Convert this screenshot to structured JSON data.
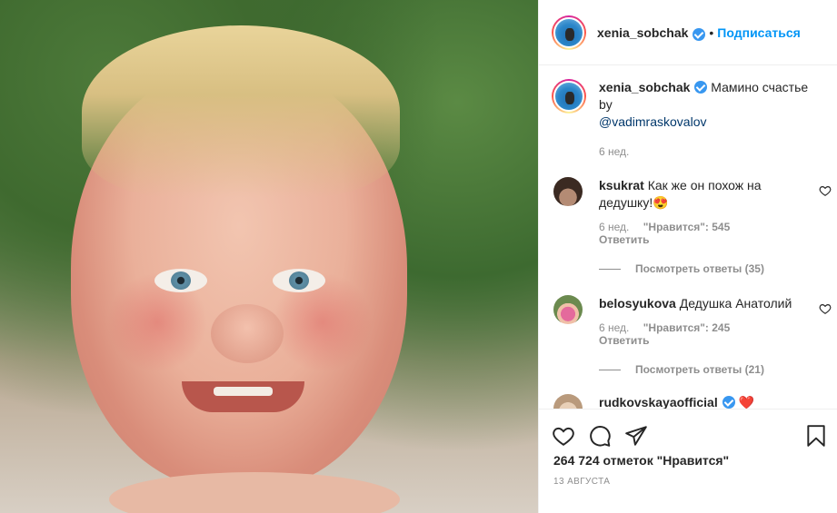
{
  "post": {
    "username": "xenia_sobchak",
    "follow_label": "Подписаться",
    "dot": "•",
    "caption_text": "Мамино счастье by",
    "caption_mention": "@vadimraskovalov",
    "caption_time": "6 нед."
  },
  "comments": [
    {
      "username": "ksukrat",
      "text": "Как же он похож на дедушку!😍",
      "time": "6 нед.",
      "likes": "\"Нравится\": 545",
      "reply_label": "Ответить",
      "view_replies": "Посмотреть ответы (35)"
    },
    {
      "username": "belosyukova",
      "text": "Дедушка Анатолий",
      "time": "6 нед.",
      "likes": "\"Нравится\": 245",
      "reply_label": "Ответить",
      "view_replies": "Посмотреть ответы (21)"
    },
    {
      "username": "rudkovskayaofficial",
      "text": "❤️"
    }
  ],
  "footer": {
    "likes_text": "264 724 отметок \"Нравится\"",
    "date": "13 АВГУСТА"
  },
  "icons": [
    "heart-icon",
    "comment-icon",
    "share-icon",
    "bookmark-icon",
    "verified-icon"
  ],
  "colors": {
    "link": "#00376b",
    "follow": "#0095f6",
    "verified": "#3897f0",
    "muted": "#8e8e8e"
  }
}
